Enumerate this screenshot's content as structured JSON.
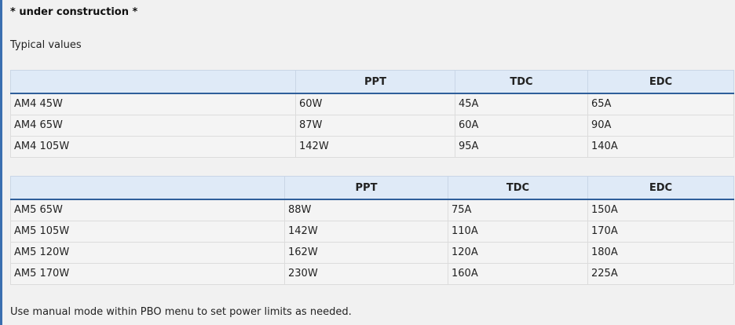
{
  "notice": "* under construction *",
  "intro": "Typical values",
  "tables": [
    {
      "headers": [
        "",
        "PPT",
        "TDC",
        "EDC"
      ],
      "rows": [
        [
          "AM4 45W",
          "60W",
          "45A",
          "65A"
        ],
        [
          "AM4 65W",
          "87W",
          "60A",
          "90A"
        ],
        [
          "AM4 105W",
          "142W",
          "95A",
          "140A"
        ]
      ]
    },
    {
      "headers": [
        "",
        "PPT",
        "TDC",
        "EDC"
      ],
      "rows": [
        [
          "AM5 65W",
          "88W",
          "75A",
          "150A"
        ],
        [
          "AM5 105W",
          "142W",
          "110A",
          "170A"
        ],
        [
          "AM5 120W",
          "162W",
          "120A",
          "180A"
        ],
        [
          "AM5 170W",
          "230W",
          "160A",
          "225A"
        ]
      ]
    }
  ],
  "footer": "Use manual mode within PBO menu to set power limits as needed.",
  "colors": {
    "accent": "#3a6fb0",
    "header_bg": "#dfeaf7",
    "header_rule": "#2f5f9a"
  }
}
